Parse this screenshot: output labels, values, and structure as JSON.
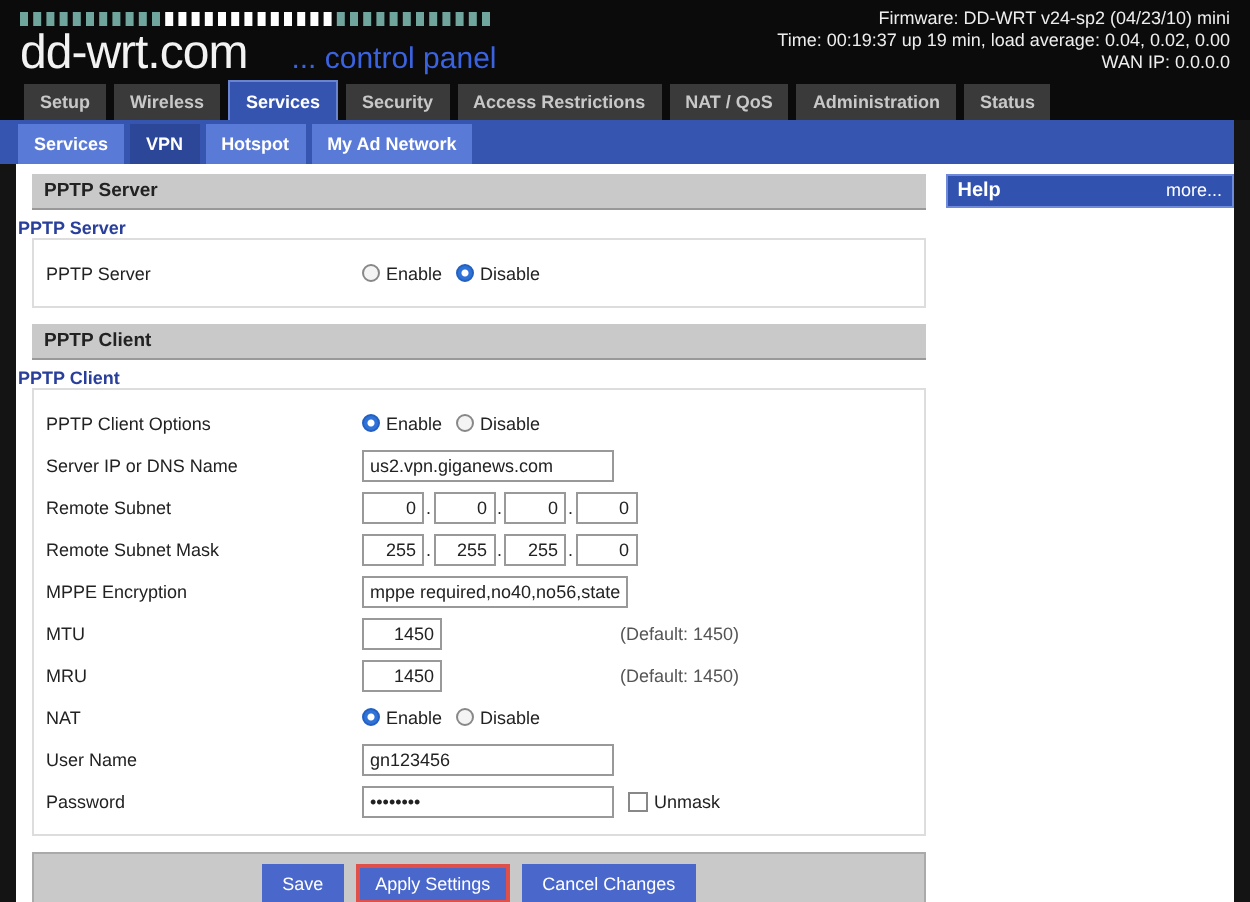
{
  "header": {
    "logo": "dd-wrt.com",
    "tagline": "... control panel",
    "firmware": "Firmware: DD-WRT v24-sp2 (04/23/10) mini",
    "time": "Time: 00:19:37 up 19 min, load average: 0.04, 0.02, 0.00",
    "wan_ip": "WAN IP: 0.0.0.0"
  },
  "tabs": [
    {
      "label": "Setup",
      "selected": false
    },
    {
      "label": "Wireless",
      "selected": false
    },
    {
      "label": "Services",
      "selected": true
    },
    {
      "label": "Security",
      "selected": false
    },
    {
      "label": "Access Restrictions",
      "selected": false
    },
    {
      "label": "NAT / QoS",
      "selected": false
    },
    {
      "label": "Administration",
      "selected": false
    },
    {
      "label": "Status",
      "selected": false
    }
  ],
  "subtabs": [
    {
      "label": "Services",
      "selected": false
    },
    {
      "label": "VPN",
      "selected": true
    },
    {
      "label": "Hotspot",
      "selected": false
    },
    {
      "label": "My Ad Network",
      "selected": false
    }
  ],
  "sections": [
    {
      "heading": "PPTP Server",
      "legend": "PPTP Server",
      "rows": [
        {
          "kind": "radio",
          "label": "PPTP Server",
          "options": [
            {
              "label": "Enable",
              "selected": false
            },
            {
              "label": "Disable",
              "selected": true
            }
          ]
        }
      ]
    },
    {
      "heading": "PPTP Client",
      "legend": "PPTP Client",
      "rows": [
        {
          "kind": "radio",
          "label": "PPTP Client Options",
          "options": [
            {
              "label": "Enable",
              "selected": true
            },
            {
              "label": "Disable",
              "selected": false
            }
          ]
        },
        {
          "kind": "text",
          "label": "Server IP or DNS Name",
          "value": "us2.vpn.giganews.com"
        },
        {
          "kind": "ip",
          "label": "Remote Subnet",
          "octets": [
            "0",
            "0",
            "0",
            "0"
          ],
          "separator": "."
        },
        {
          "kind": "ip",
          "label": "Remote Subnet Mask",
          "octets": [
            "255",
            "255",
            "255",
            "0"
          ],
          "separator": "."
        },
        {
          "kind": "text",
          "label": "MPPE Encryption",
          "value": "mppe required,no40,no56,state"
        },
        {
          "kind": "number",
          "label": "MTU",
          "value": "1450",
          "hint": "(Default: 1450)"
        },
        {
          "kind": "number",
          "label": "MRU",
          "value": "1450",
          "hint": "(Default: 1450)"
        },
        {
          "kind": "radio",
          "label": "NAT",
          "options": [
            {
              "label": "Enable",
              "selected": true
            },
            {
              "label": "Disable",
              "selected": false
            }
          ]
        },
        {
          "kind": "text",
          "label": "User Name",
          "value": "gn123456"
        },
        {
          "kind": "password",
          "label": "Password",
          "value": "••••••••",
          "checkbox": {
            "label": "Unmask",
            "checked": false
          }
        }
      ]
    }
  ],
  "buttons": [
    {
      "label": "Save",
      "highlighted": false
    },
    {
      "label": "Apply Settings",
      "highlighted": true
    },
    {
      "label": "Cancel Changes",
      "highlighted": false
    }
  ],
  "help": {
    "title": "Help",
    "more": "more..."
  }
}
